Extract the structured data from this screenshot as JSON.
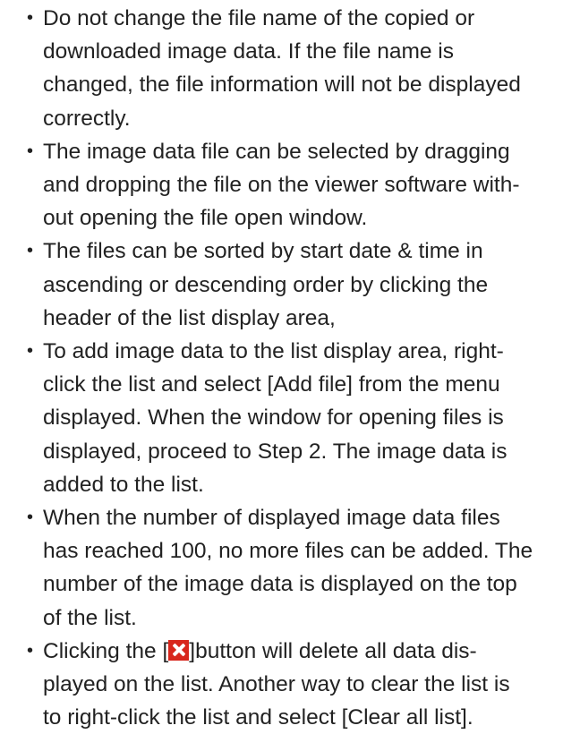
{
  "notes": [
    {
      "lines": [
        "Do not change the file name of the copied or",
        "downloaded image data. If the file name is",
        "changed, the file information will not be displayed",
        "correctly."
      ]
    },
    {
      "lines": [
        "The image data file can be selected by dragging",
        "and dropping the file on the viewer software with-",
        "out opening the file open window."
      ]
    },
    {
      "lines": [
        "The files can be sorted by start date & time in",
        "ascending or descending order by clicking the",
        "header of the list display area,"
      ]
    },
    {
      "lines": [
        "To add image data to the list display area, right-",
        "click the list and select [Add file] from the menu",
        "displayed. When the window for opening files is",
        "displayed, proceed to Step 2. The image data is",
        "added to the list."
      ]
    },
    {
      "lines": [
        "When the number of displayed image data files",
        "has reached 100, no more files can be added. The",
        "number of the image data is displayed on the top",
        "of the list."
      ]
    },
    {
      "first_before_icon": "Clicking the [",
      "first_after_icon": "]button will delete all data dis-",
      "icon": "red-x-delete-icon",
      "icon_color": "#d8261c",
      "lines": [
        "played on the list. Another way to clear the list is",
        "to right-click the list and select [Clear all list]."
      ]
    }
  ]
}
